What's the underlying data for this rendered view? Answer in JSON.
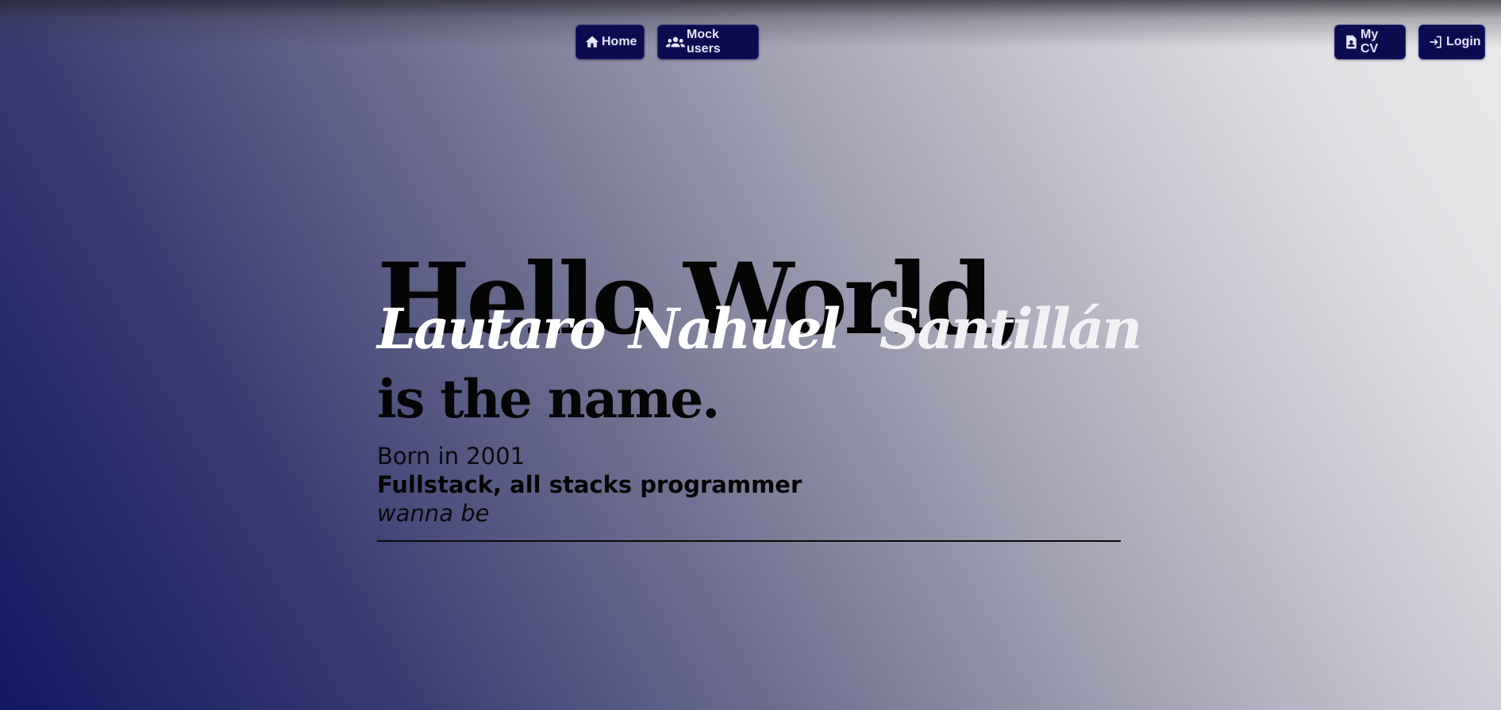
{
  "nav": {
    "home_label": "Home",
    "home_icon": "home-icon",
    "mock_users_label": "Mock users",
    "mock_users_icon": "users-icon",
    "cv_label": "My CV",
    "cv_icon": "document-user-icon",
    "login_label": "Login",
    "login_icon": "login-icon"
  },
  "hero": {
    "greeting": "Hello World,",
    "name_first": "Lautaro",
    "name_middle": "Nahuel",
    "name_last": "Santillán",
    "name_suffix": "is the name.",
    "born": "Born in 2001",
    "role": "Fullstack, all stacks programmer",
    "role_suffix": "wanna be"
  },
  "colors": {
    "button_bg": "#0c0b4f",
    "button_text": "#e6e6ff",
    "gradient_dark": "#141761",
    "gradient_light": "#ebebeb",
    "name_text": "#ffffff",
    "heading_text": "#050505"
  }
}
